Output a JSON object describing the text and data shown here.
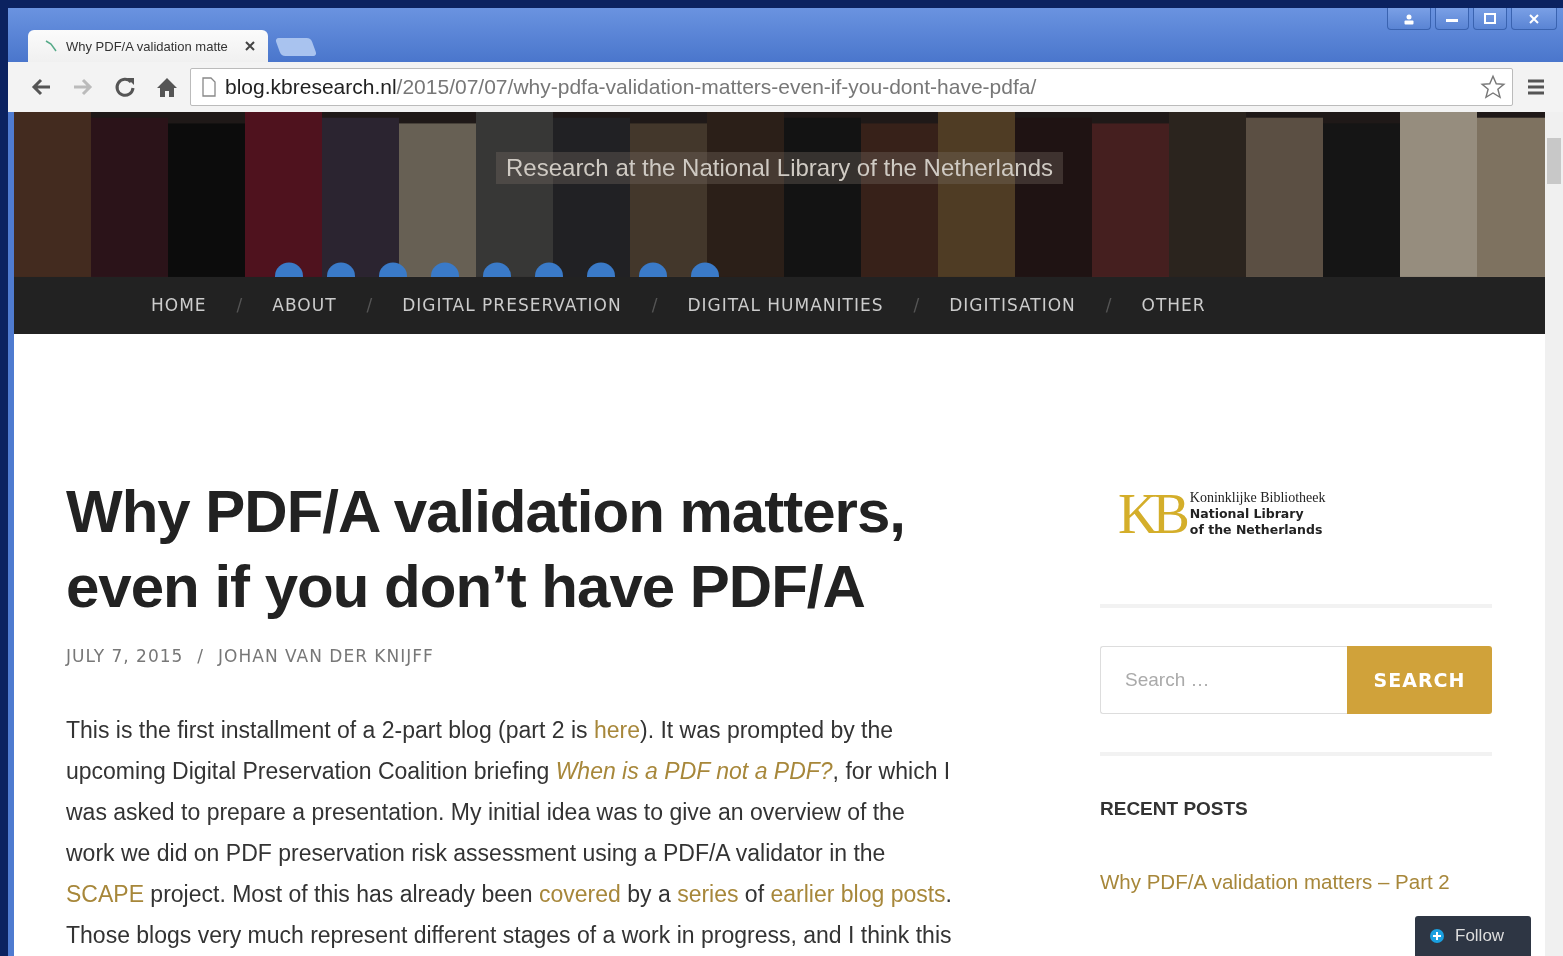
{
  "browser": {
    "tab_title": "Why PDF/A validation matte",
    "url_host": "blog.kbresearch.nl",
    "url_path": "/2015/07/07/why-pdfa-validation-matters-even-if-you-dont-have-pdfa/"
  },
  "header": {
    "tagline": "Research at the National Library of the Netherlands"
  },
  "nav": [
    "HOME",
    "ABOUT",
    "DIGITAL PRESERVATION",
    "DIGITAL HUMANITIES",
    "DIGITISATION",
    "OTHER"
  ],
  "nav_separator": "/",
  "post": {
    "title": "Why PDF/A validation matters, even if you don’t have PDF/A",
    "date": "JULY 7, 2015",
    "meta_separator": "/",
    "author": "JOHAN VAN DER KNIJFF",
    "paragraph": [
      {
        "kind": "text",
        "text": "This is the first installment of a 2-part blog (part 2 is "
      },
      {
        "kind": "link",
        "text": "here"
      },
      {
        "kind": "text",
        "text": "). It was prompted by the upcoming Digital Preservation Coalition briefing "
      },
      {
        "kind": "italic-link",
        "text": "When is a PDF not a PDF?"
      },
      {
        "kind": "text",
        "text": ", for which I was asked to prepare a presentation. My initial idea was to give an overview of the work we did on PDF preservation risk assessment using a PDF/A validator in the "
      },
      {
        "kind": "link",
        "text": "SCAPE"
      },
      {
        "kind": "text",
        "text": " project. Most of this has already been "
      },
      {
        "kind": "link",
        "text": "covered"
      },
      {
        "kind": "text",
        "text": " by a "
      },
      {
        "kind": "link",
        "text": "series"
      },
      {
        "kind": "text",
        "text": " of "
      },
      {
        "kind": "link",
        "text": "earlier blog posts"
      },
      {
        "kind": "text",
        "text": ". Those blogs very much represent different stages of a work in progress, and I think this"
      }
    ]
  },
  "sidebar": {
    "logo": {
      "mark": "KB",
      "line_1": "Koninklijke Bibliotheek",
      "line_2": "National Library",
      "line_3": "of the Netherlands"
    },
    "search": {
      "placeholder": "Search …",
      "button": "SEARCH"
    },
    "recent_posts": {
      "heading": "RECENT POSTS",
      "items": [
        "Why PDF/A validation matters – Part 2"
      ]
    }
  },
  "follow_button": "Follow"
}
